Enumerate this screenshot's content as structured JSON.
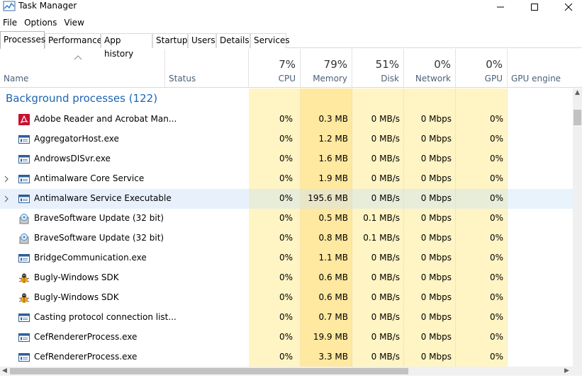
{
  "window": {
    "title": "Task Manager"
  },
  "menu": [
    "File",
    "Options",
    "View"
  ],
  "tabs": [
    "Processes",
    "Performance",
    "App history",
    "Startup",
    "Users",
    "Details",
    "Services"
  ],
  "header": {
    "name_label": "Name",
    "status_label": "Status",
    "cpu_pct": "7%",
    "cpu_label": "CPU",
    "memory_pct": "79%",
    "memory_label": "Memory",
    "disk_pct": "51%",
    "disk_label": "Disk",
    "network_pct": "0%",
    "network_label": "Network",
    "gpu_pct": "0%",
    "gpu_label": "GPU",
    "gpu_engine_label": "GPU engine"
  },
  "group": {
    "title": "Background processes (122)"
  },
  "colors": {
    "group_title": "#1e64b4",
    "header_label": "#4c607a",
    "cpu_bg": "#fff4c4",
    "memory_bg": "#ffe8a0",
    "disk_bg": "#fff4c4",
    "selected_row": "#e8f1fb"
  },
  "processes": [
    {
      "name": "Adobe Reader and Acrobat Man...",
      "icon": "adobe-acrobat-icon",
      "expandable": false,
      "cpu": "0%",
      "memory": "0.3 MB",
      "disk": "0 MB/s",
      "network": "0 Mbps",
      "gpu": "0%"
    },
    {
      "name": "AggregatorHost.exe",
      "icon": "app-window-icon",
      "expandable": false,
      "cpu": "0%",
      "memory": "1.2 MB",
      "disk": "0 MB/s",
      "network": "0 Mbps",
      "gpu": "0%"
    },
    {
      "name": "AndrowsDISvr.exe",
      "icon": "app-window-icon",
      "expandable": false,
      "cpu": "0%",
      "memory": "1.6 MB",
      "disk": "0 MB/s",
      "network": "0 Mbps",
      "gpu": "0%"
    },
    {
      "name": "Antimalware Core Service",
      "icon": "app-window-icon",
      "expandable": true,
      "cpu": "0%",
      "memory": "1.9 MB",
      "disk": "0 MB/s",
      "network": "0 Mbps",
      "gpu": "0%"
    },
    {
      "name": "Antimalware Service Executable",
      "icon": "app-window-icon",
      "expandable": true,
      "selected": true,
      "cpu": "0%",
      "memory": "195.6 MB",
      "disk": "0 MB/s",
      "network": "0 Mbps",
      "gpu": "0%"
    },
    {
      "name": "BraveSoftware Update (32 bit)",
      "icon": "installer-icon",
      "expandable": false,
      "cpu": "0%",
      "memory": "0.5 MB",
      "disk": "0.1 MB/s",
      "network": "0 Mbps",
      "gpu": "0%"
    },
    {
      "name": "BraveSoftware Update (32 bit)",
      "icon": "installer-icon",
      "expandable": false,
      "cpu": "0%",
      "memory": "0.8 MB",
      "disk": "0.1 MB/s",
      "network": "0 Mbps",
      "gpu": "0%"
    },
    {
      "name": "BridgeCommunication.exe",
      "icon": "app-window-icon",
      "expandable": false,
      "cpu": "0%",
      "memory": "1.1 MB",
      "disk": "0 MB/s",
      "network": "0 Mbps",
      "gpu": "0%"
    },
    {
      "name": "Bugly-Windows SDK",
      "icon": "bugly-bug-icon",
      "expandable": false,
      "cpu": "0%",
      "memory": "0.6 MB",
      "disk": "0 MB/s",
      "network": "0 Mbps",
      "gpu": "0%"
    },
    {
      "name": "Bugly-Windows SDK",
      "icon": "bugly-bug-icon",
      "expandable": false,
      "cpu": "0%",
      "memory": "0.6 MB",
      "disk": "0 MB/s",
      "network": "0 Mbps",
      "gpu": "0%"
    },
    {
      "name": "Casting protocol connection list...",
      "icon": "app-window-icon",
      "expandable": false,
      "cpu": "0%",
      "memory": "0.7 MB",
      "disk": "0 MB/s",
      "network": "0 Mbps",
      "gpu": "0%"
    },
    {
      "name": "CefRendererProcess.exe",
      "icon": "app-window-icon",
      "expandable": false,
      "cpu": "0%",
      "memory": "19.9 MB",
      "disk": "0 MB/s",
      "network": "0 Mbps",
      "gpu": "0%"
    },
    {
      "name": "CefRendererProcess.exe",
      "icon": "app-window-icon",
      "expandable": false,
      "cpu": "0%",
      "memory": "3.3 MB",
      "disk": "0 MB/s",
      "network": "0 Mbps",
      "gpu": "0%"
    }
  ]
}
